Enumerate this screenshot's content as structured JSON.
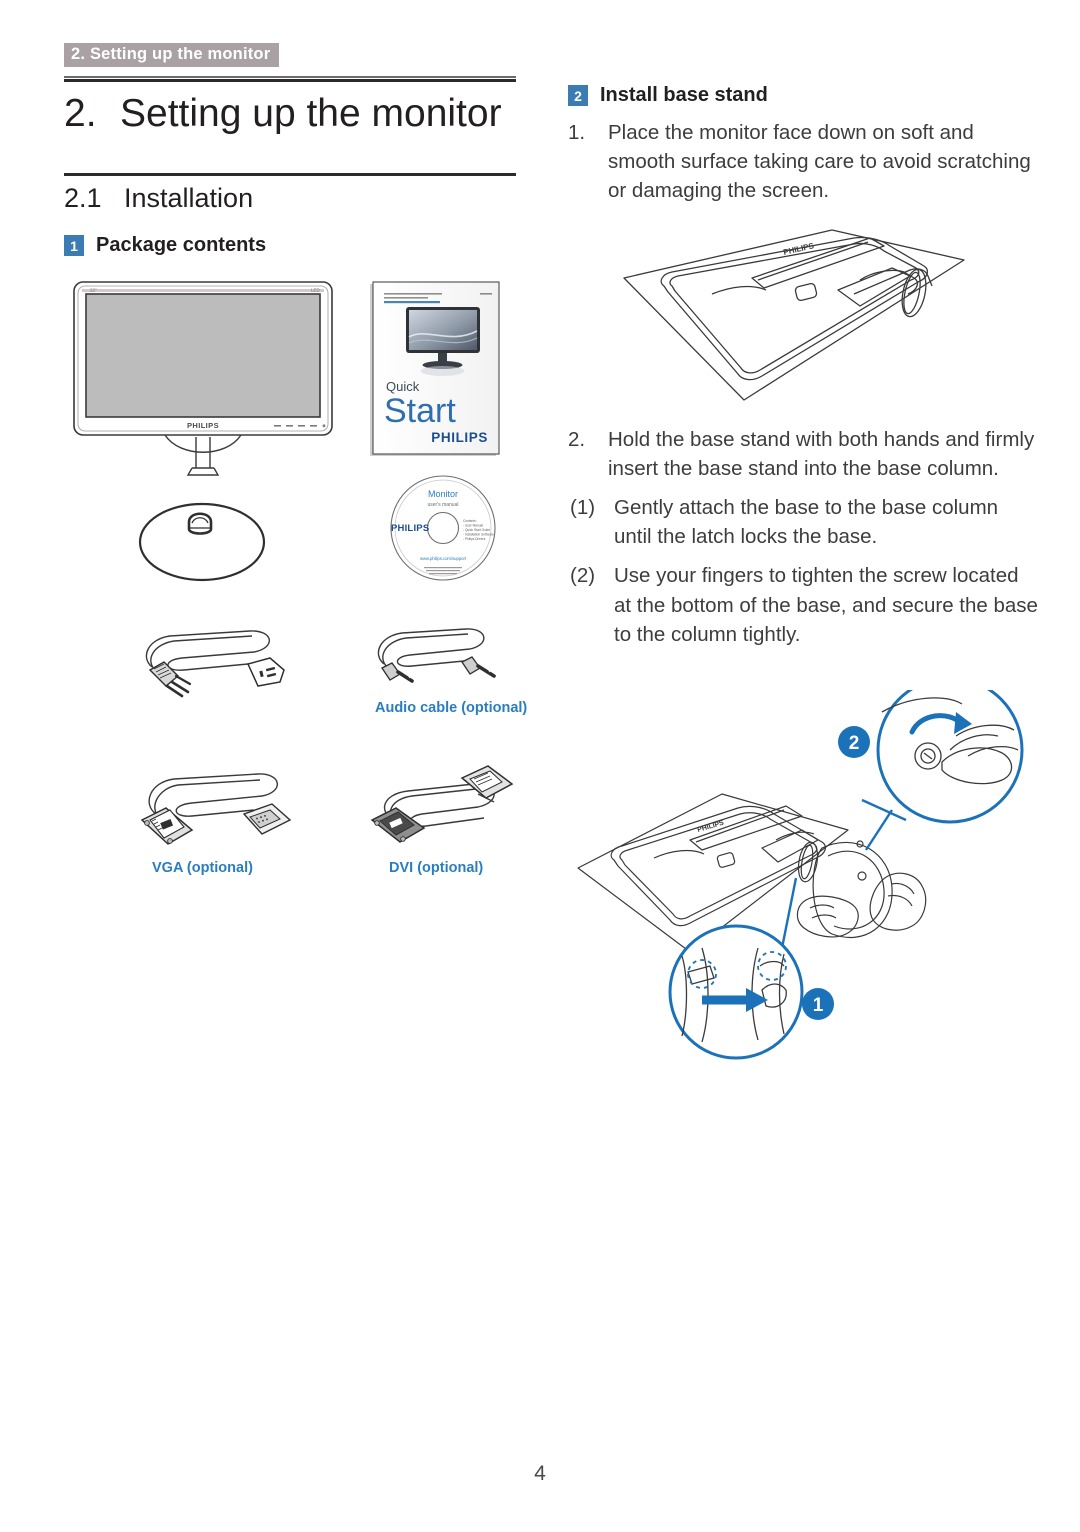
{
  "page": {
    "running_header": "2. Setting up the monitor",
    "page_number": "4"
  },
  "chapter": {
    "number": "2.",
    "title": "Setting up the monitor"
  },
  "section": {
    "number": "2.1",
    "title": "Installation"
  },
  "package_contents": {
    "badge": "1",
    "heading": "Package contents",
    "items": [
      {
        "name": "monitor",
        "caption": ""
      },
      {
        "name": "quick-start-guide",
        "caption": ""
      },
      {
        "name": "base-stand",
        "caption": ""
      },
      {
        "name": "cd-rom",
        "caption": ""
      },
      {
        "name": "power-cable",
        "caption": ""
      },
      {
        "name": "audio-cable",
        "caption": "Audio cable (optional)"
      },
      {
        "name": "vga-cable",
        "caption": "VGA (optional)"
      },
      {
        "name": "dvi-cable",
        "caption": "DVI (optional)"
      }
    ],
    "captions": {
      "audio": "Audio cable (optional)",
      "vga": "VGA (optional)",
      "dvi": "DVI (optional)"
    },
    "monitor_art": {
      "brand": "PHILIPS",
      "size_label": "22\"",
      "led_label": "LED"
    },
    "quick_start_art": {
      "register_line1": "Register your product and get support at",
      "register_line2": "www.philips.com/welcome",
      "model_code": "227E",
      "word_quick": "Quick",
      "word_start": "Start",
      "brand": "PHILIPS"
    },
    "cd_art": {
      "title": "Monitor",
      "subtitle": "user's manual",
      "brand": "PHILIPS",
      "url": "www.philips.com/support",
      "contents_lines": [
        "Contents:",
        "- User Manual",
        "- Quick Start Guide",
        "- Installation Software",
        "- Philips Drivers"
      ]
    }
  },
  "install_base_stand": {
    "badge": "2",
    "heading": "Install base stand",
    "steps": [
      {
        "marker": "1.",
        "text": "Place the monitor face down on soft and smooth surface taking care to avoid scratching or damaging the screen."
      },
      {
        "marker": "2.",
        "text": "Hold the base stand with both hands and firmly insert the base stand into the base column."
      }
    ],
    "substeps": [
      {
        "marker": "(1)",
        "text": "Gently attach the base to the base column until the latch locks the base."
      },
      {
        "marker": "(2)",
        "text": "Use your fingers to tighten the screw located at the bottom of the base, and secure the base to the column tightly."
      }
    ],
    "callouts": [
      {
        "label": "2",
        "meaning": "tighten-screw-with-fingers"
      },
      {
        "label": "1",
        "meaning": "latch-locks-base"
      }
    ],
    "monitor_art_brand": "PHILIPS"
  },
  "colors": {
    "header_bg": "#a9a1a3",
    "badge_blue": "#3c7cb4",
    "caption_blue": "#2a7ec0",
    "callout_blue": "#1b72b8",
    "rule_dark": "#2b2b2b",
    "body_text": "#3d3d3d"
  }
}
